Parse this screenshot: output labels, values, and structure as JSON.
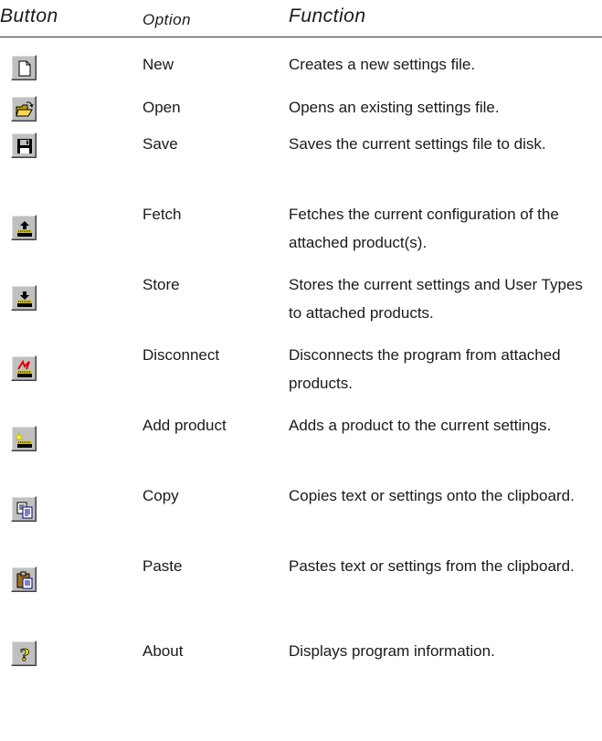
{
  "headers": {
    "button": "Button",
    "option": "Option",
    "function": "Function"
  },
  "rows": [
    {
      "icon": "new-document-icon",
      "option": "New",
      "function": "Creates a new settings file."
    },
    {
      "icon": "open-folder-icon",
      "option": "Open",
      "function": "Opens an existing settings file."
    },
    {
      "icon": "floppy-disk-icon",
      "option": "Save",
      "function": "Saves the current settings file to disk."
    },
    {
      "icon": "fetch-icon",
      "option": "Fetch",
      "function": "Fetches the current configuration of the attached product(s)."
    },
    {
      "icon": "store-icon",
      "option": "Store",
      "function": "Stores the current settings and User Types to attached products."
    },
    {
      "icon": "disconnect-icon",
      "option": "Disconnect",
      "function": "Disconnects the program from attached products."
    },
    {
      "icon": "add-product-icon",
      "option": "Add product",
      "function": "Adds a product to the current settings."
    },
    {
      "icon": "copy-icon",
      "option": "Copy",
      "function": "Copies text or settings onto the clipboard."
    },
    {
      "icon": "paste-icon",
      "option": "Paste",
      "function": "Pastes text or settings from the clipboard."
    },
    {
      "icon": "help-icon",
      "option": "About",
      "function": "Displays program information."
    }
  ]
}
